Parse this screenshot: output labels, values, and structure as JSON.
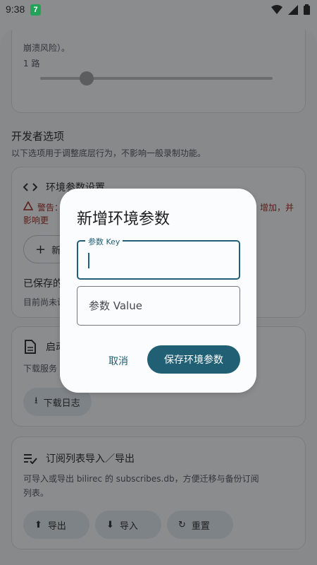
{
  "status_bar": {
    "time": "9:38",
    "badge": "7"
  },
  "section_top": {
    "text_fragment": "崩溃风险）。",
    "slider_value": "1 路",
    "slider_level": 0.2
  },
  "developer": {
    "title": "开发者选项",
    "description": "以下选项用于调整底层行为，不影响一般录制功能。",
    "env_card": {
      "icon": "code-icon",
      "title": "环境参数设置",
      "warning_line1": "警告：",
      "warning_line1_tail": "增加，并",
      "warning_line2": "影响更",
      "add_button": "新",
      "saved_label": "已保存的",
      "empty_label": "目前尚未设"
    },
    "log_card": {
      "icon": "document-icon",
      "title": "启动",
      "description": "下载服务",
      "download_button": "下载日志"
    },
    "subs_card": {
      "icon": "playlist-icon",
      "title": "订阅列表导入／导出",
      "description_line1": "可导入或导出 bilirec 的 subscribes.db，方便迁移与备份订阅",
      "description_line2": "列表。",
      "export_button": "导出",
      "import_button": "导入",
      "reset_button": "重置"
    }
  },
  "dialog": {
    "title": "新增环境参数",
    "key_label": "参数 Key",
    "key_value": "",
    "value_placeholder": "参数 Value",
    "cancel_button": "取消",
    "save_button": "保存环境参数"
  },
  "colors": {
    "primary": "#215f74",
    "warning": "#b3261e",
    "scrim": "#8a8c8e"
  }
}
